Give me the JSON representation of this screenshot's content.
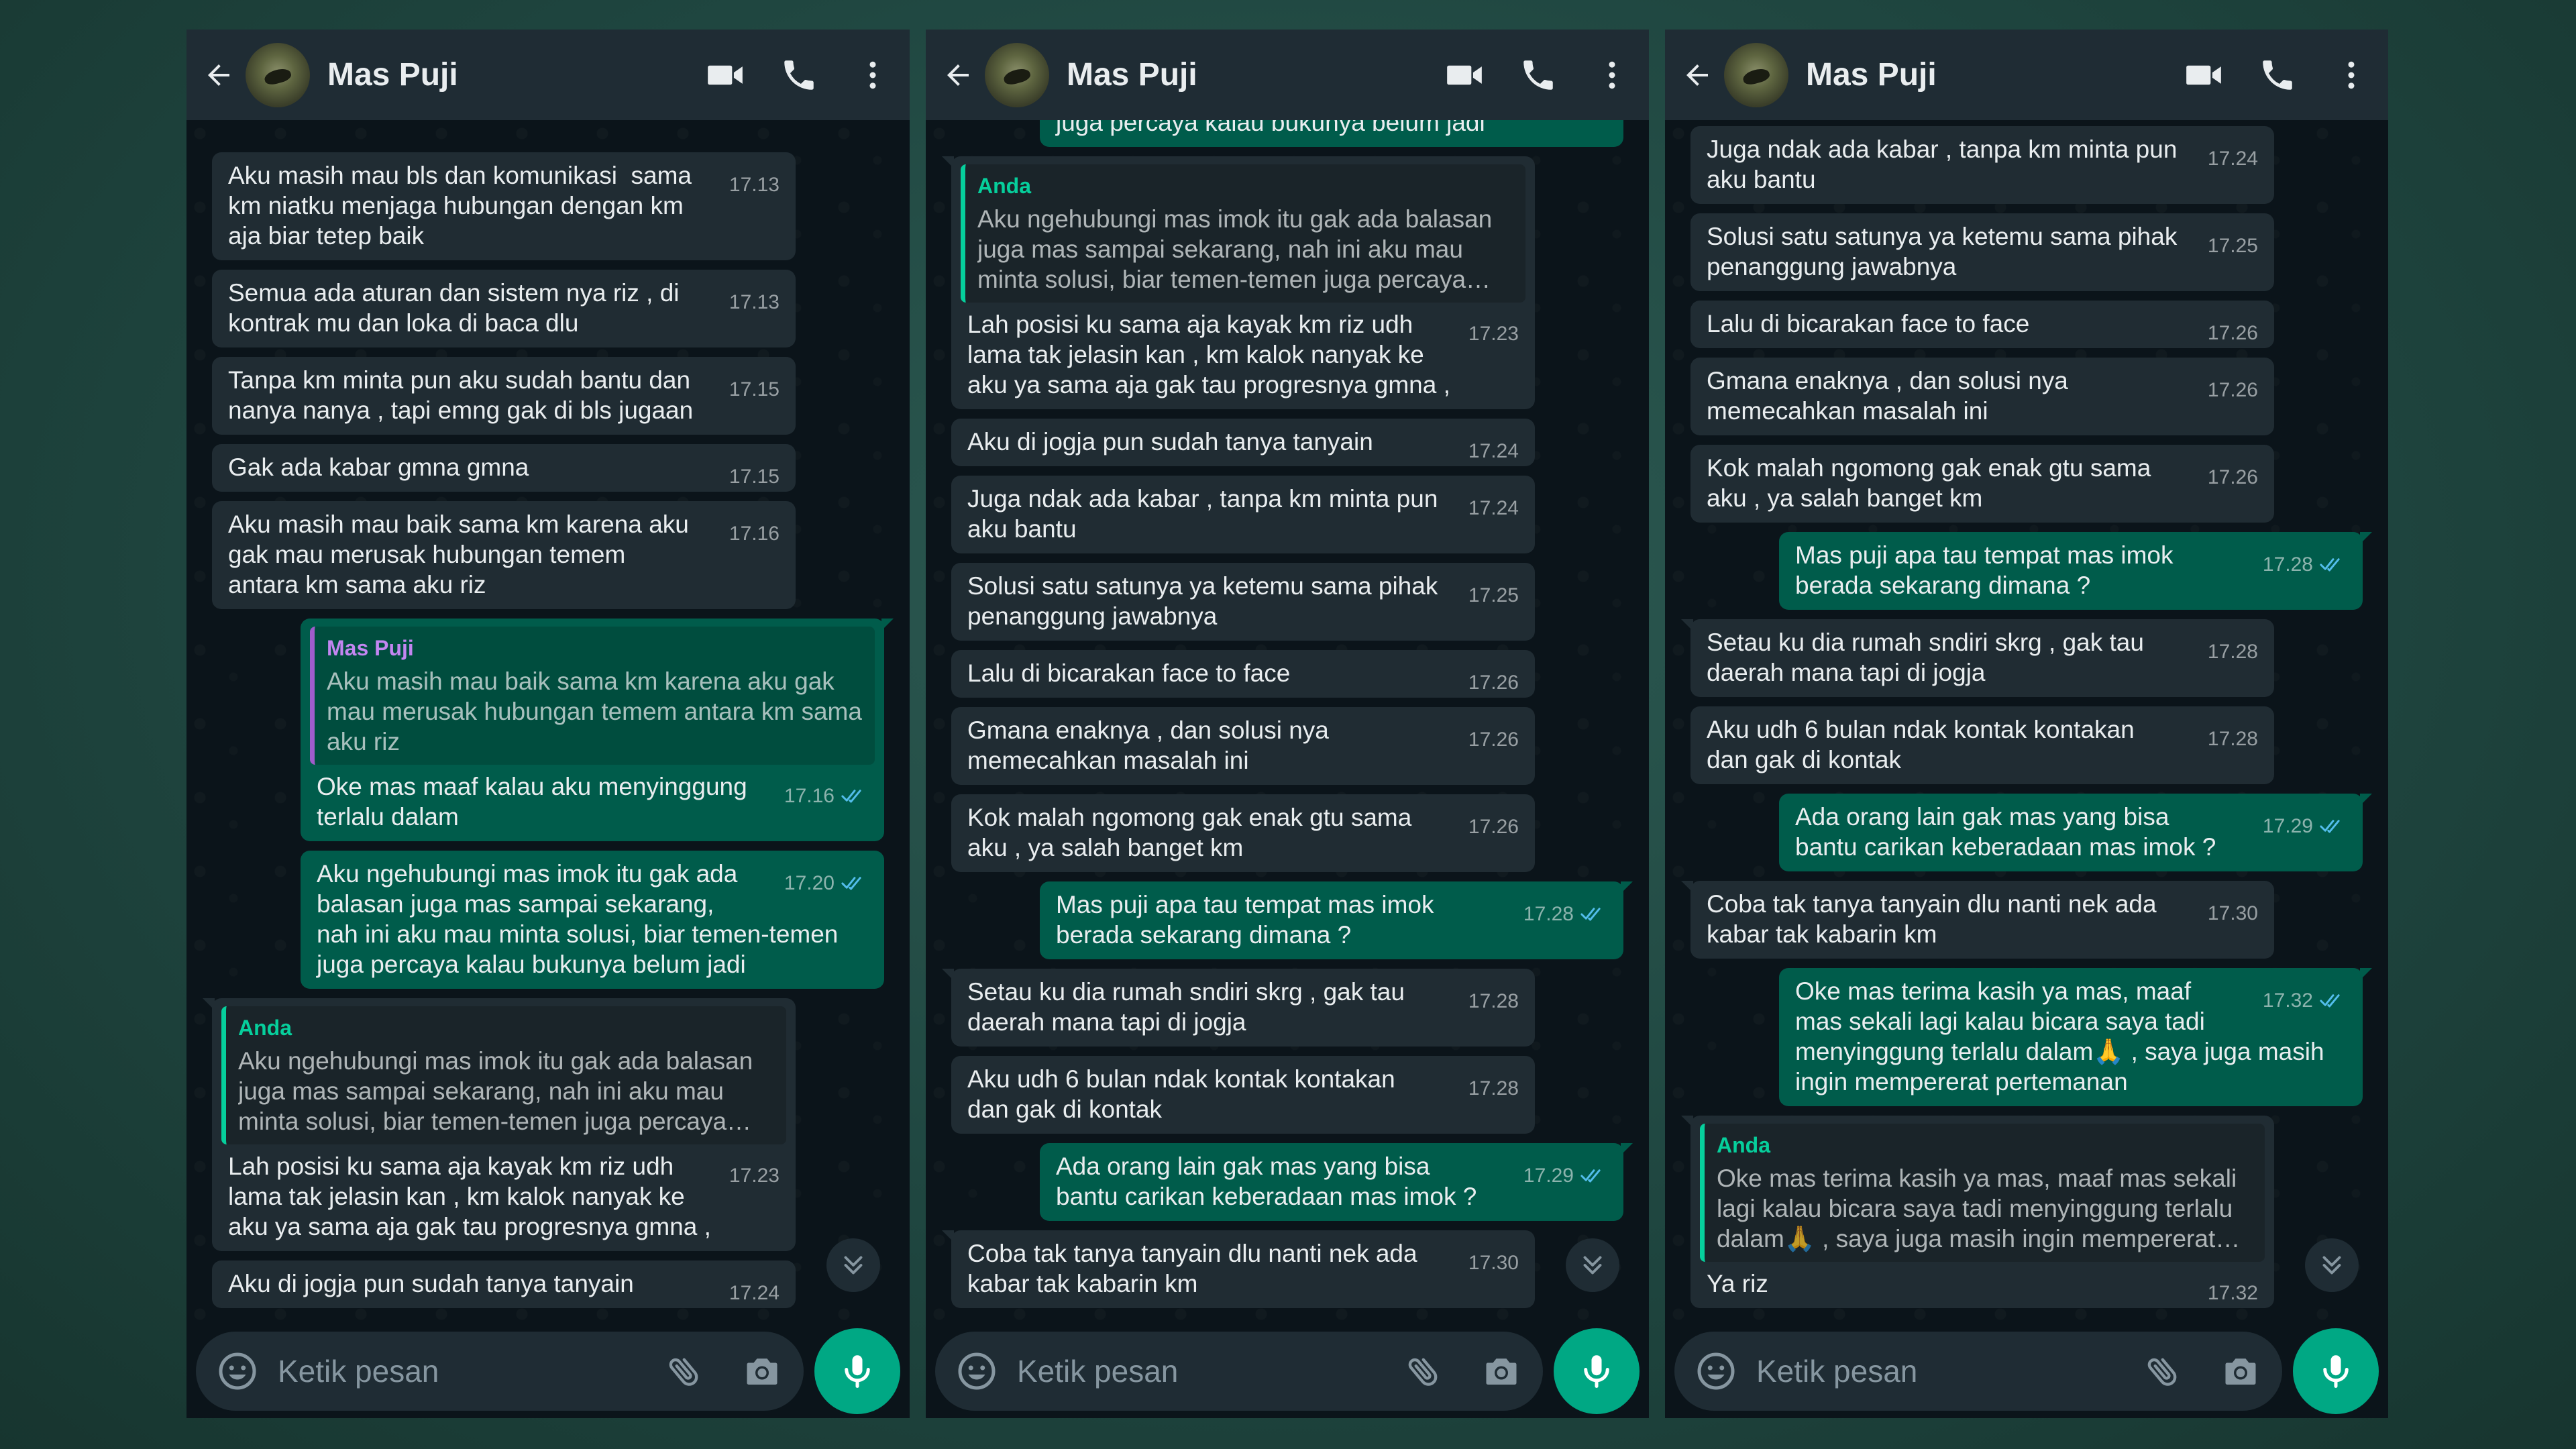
{
  "colors": {
    "background": "#1f4640",
    "panel": "#0b141a",
    "header": "#1f2c34",
    "incoming": "#202c33",
    "outgoing": "#005c4b",
    "accent": "#00a884",
    "read_ticks": "#53bdeb"
  },
  "header": {
    "contact_name": "Mas Puji",
    "icons": [
      "back-arrow-icon",
      "avatar",
      "video-call-icon",
      "voice-call-icon",
      "more-options-icon"
    ]
  },
  "footer": {
    "placeholder": "Ketik pesan",
    "icons": [
      "emoji-icon",
      "attach-icon",
      "camera-icon",
      "mic-icon"
    ]
  },
  "panels": [
    {
      "messages": [
        {
          "dir": "in",
          "text": "Aku masih mau bls dan komunikasi  sama km niatku menjaga hubungan dengan km aja biar tetep baik",
          "time": "17.13"
        },
        {
          "dir": "in",
          "text": "Semua ada aturan dan sistem nya riz , di kontrak mu dan loka di baca dlu",
          "time": "17.13"
        },
        {
          "dir": "in",
          "text": "Tanpa km minta pun aku sudah bantu dan nanya nanya , tapi emng gak di bls jugaan",
          "time": "17.15"
        },
        {
          "dir": "in",
          "text": "Gak ada kabar gmna gmna",
          "time": "17.15"
        },
        {
          "dir": "in",
          "text": "Aku masih mau baik sama km karena aku gak mau merusak hubungan temem antara km sama aku riz",
          "time": "17.16"
        },
        {
          "dir": "out",
          "first": true,
          "quote_author": "Mas Puji",
          "quote_text": "Aku masih mau baik sama km karena aku gak mau merusak hubungan temem antara km sama aku riz",
          "text": "Oke mas maaf kalau aku menyinggung terlalu dalam",
          "time": "17.16",
          "read": true
        },
        {
          "dir": "out",
          "text": "Aku ngehubungi mas imok itu gak ada balasan juga mas sampai sekarang, nah ini aku mau minta solusi, biar temen-temen juga percaya kalau bukunya belum jadi",
          "time": "17.20",
          "read": true
        },
        {
          "dir": "in",
          "first": true,
          "quote_author": "Anda",
          "quote_text": "Aku ngehubungi mas imok itu gak ada balasan juga mas sampai sekarang, nah ini aku mau minta solusi, biar temen-temen juga percaya kalau bukunya belum jadi",
          "text": "Lah posisi ku sama aja kayak km riz udh lama tak jelasin kan , km kalok nanyak ke aku ya sama aja gak tau progresnya gmna ,",
          "time": "17.23"
        },
        {
          "dir": "in",
          "text": "Aku di jogja pun sudah tanya tanyain",
          "time": "17.24"
        }
      ]
    },
    {
      "messages": [
        {
          "dir": "out",
          "text": "Aku ngehubungi mas imok itu gak ada balasan juga mas sampai sekarang, nah ini aku mau minta solusi, biar temen-temen juga percaya kalau bukunya belum jadi",
          "time": "17.20",
          "read": true
        },
        {
          "dir": "in",
          "first": true,
          "quote_author": "Anda",
          "quote_text": "Aku ngehubungi mas imok itu gak ada balasan juga mas sampai sekarang, nah ini aku mau minta solusi, biar temen-temen juga percaya kalau bukunya belum jadi",
          "text": "Lah posisi ku sama aja kayak km riz udh lama tak jelasin kan , km kalok nanyak ke aku ya sama aja gak tau progresnya gmna ,",
          "time": "17.23"
        },
        {
          "dir": "in",
          "text": "Aku di jogja pun sudah tanya tanyain",
          "time": "17.24"
        },
        {
          "dir": "in",
          "text": "Juga ndak ada kabar , tanpa km minta pun aku bantu",
          "time": "17.24"
        },
        {
          "dir": "in",
          "text": "Solusi satu satunya ya ketemu sama pihak penanggung jawabnya",
          "time": "17.25"
        },
        {
          "dir": "in",
          "text": "Lalu di bicarakan face to face",
          "time": "17.26"
        },
        {
          "dir": "in",
          "text": "Gmana enaknya , dan solusi nya memecahkan masalah ini",
          "time": "17.26"
        },
        {
          "dir": "in",
          "text": "Kok malah ngomong gak enak gtu sama aku , ya salah banget km",
          "time": "17.26"
        },
        {
          "dir": "out",
          "first": true,
          "text": "Mas puji apa tau tempat mas imok berada sekarang dimana ?",
          "time": "17.28",
          "read": true
        },
        {
          "dir": "in",
          "first": true,
          "text": "Setau ku dia rumah sndiri skrg , gak tau daerah mana tapi di jogja",
          "time": "17.28"
        },
        {
          "dir": "in",
          "text": "Aku udh 6 bulan ndak kontak kontakan dan gak di kontak",
          "time": "17.28"
        },
        {
          "dir": "out",
          "first": true,
          "text": "Ada orang lain gak mas yang bisa bantu carikan keberadaan mas imok ?",
          "time": "17.29",
          "read": true
        },
        {
          "dir": "in",
          "first": true,
          "text": "Coba tak tanya tanyain dlu nanti nek ada kabar tak kabarin km",
          "time": "17.30"
        }
      ]
    },
    {
      "messages": [
        {
          "dir": "in",
          "text": "Juga ndak ada kabar , tanpa km minta pun aku bantu",
          "time": "17.24"
        },
        {
          "dir": "in",
          "text": "Solusi satu satunya ya ketemu sama pihak penanggung jawabnya",
          "time": "17.25"
        },
        {
          "dir": "in",
          "text": "Lalu di bicarakan face to face",
          "time": "17.26"
        },
        {
          "dir": "in",
          "text": "Gmana enaknya , dan solusi nya memecahkan masalah ini",
          "time": "17.26"
        },
        {
          "dir": "in",
          "text": "Kok malah ngomong gak enak gtu sama aku , ya salah banget km",
          "time": "17.26"
        },
        {
          "dir": "out",
          "first": true,
          "text": "Mas puji apa tau tempat mas imok berada sekarang dimana ?",
          "time": "17.28",
          "read": true
        },
        {
          "dir": "in",
          "first": true,
          "text": "Setau ku dia rumah sndiri skrg , gak tau daerah mana tapi di jogja",
          "time": "17.28"
        },
        {
          "dir": "in",
          "text": "Aku udh 6 bulan ndak kontak kontakan dan gak di kontak",
          "time": "17.28"
        },
        {
          "dir": "out",
          "first": true,
          "text": "Ada orang lain gak mas yang bisa bantu carikan keberadaan mas imok ?",
          "time": "17.29",
          "read": true
        },
        {
          "dir": "in",
          "first": true,
          "text": "Coba tak tanya tanyain dlu nanti nek ada kabar tak kabarin km",
          "time": "17.30"
        },
        {
          "dir": "out",
          "first": true,
          "text": "Oke mas terima kasih ya mas, maaf mas sekali lagi kalau bicara saya tadi menyinggung terlalu dalam🙏 , saya juga masih ingin mempererat pertemanan",
          "time": "17.32",
          "read": true
        },
        {
          "dir": "in",
          "first": true,
          "quote_author": "Anda",
          "quote_text": "Oke mas terima kasih ya mas, maaf mas sekali lagi kalau bicara saya tadi menyinggung terlalu dalam🙏 , saya juga masih ingin mempererat pertemanan",
          "text": "Ya riz",
          "time": "17.32"
        }
      ]
    }
  ]
}
